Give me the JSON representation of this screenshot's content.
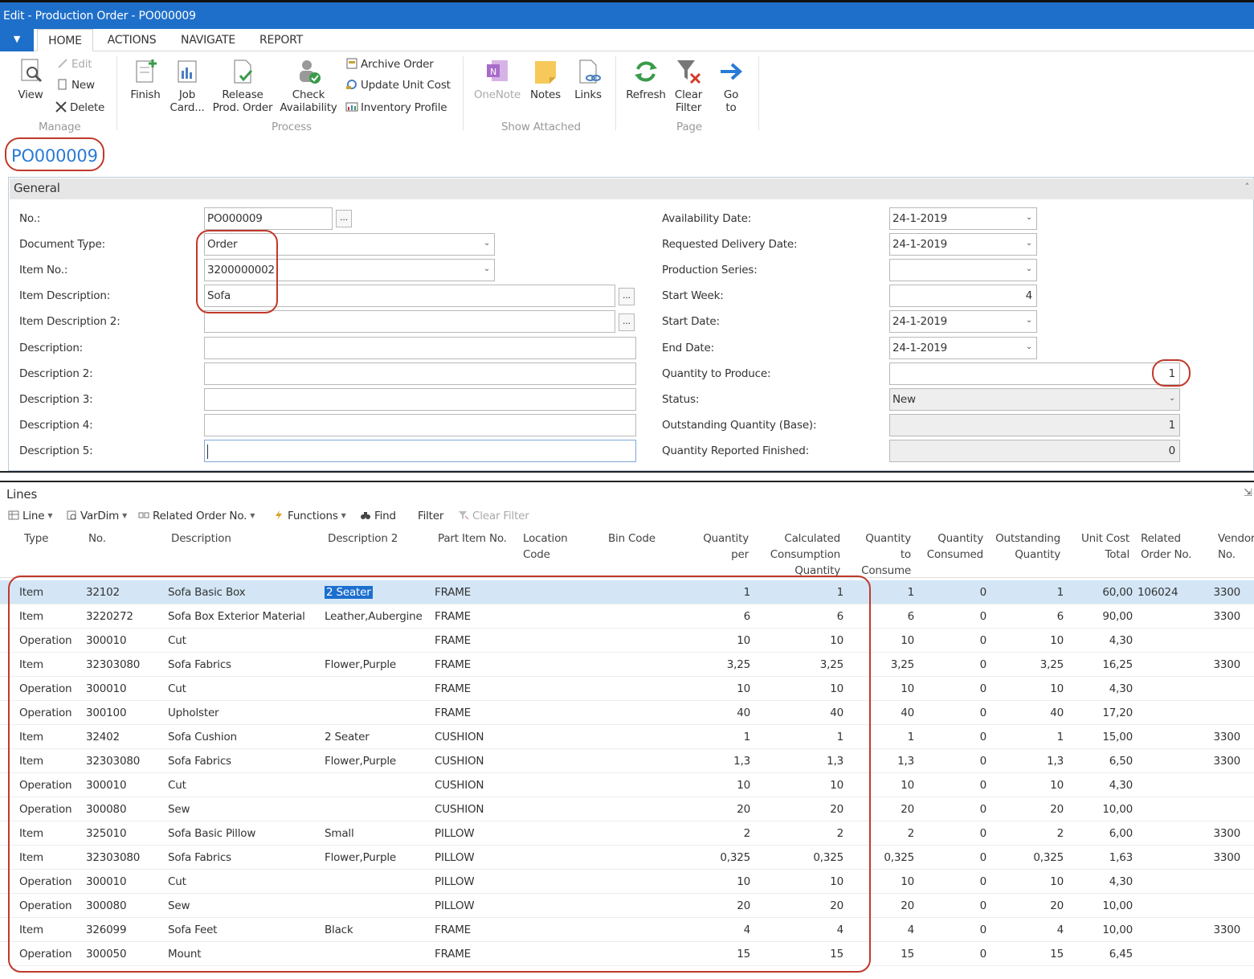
{
  "window": {
    "title": "Edit - Production Order - PO000009"
  },
  "ribbon": {
    "menu_arrow": "▼",
    "tabs": [
      "HOME",
      "ACTIONS",
      "NAVIGATE",
      "REPORT"
    ],
    "view": "View",
    "edit": "Edit",
    "new": "New",
    "delete": "Delete",
    "finish": "Finish",
    "job_card": [
      "Job",
      "Card..."
    ],
    "release": [
      "Release",
      "Prod. Order"
    ],
    "check": [
      "Check",
      "Availability"
    ],
    "archive": "Archive Order",
    "update_cost": "Update Unit Cost",
    "inventory_profile": "Inventory Profile",
    "onenote": "OneNote",
    "notes": "Notes",
    "links": "Links",
    "refresh": "Refresh",
    "clear_filter": [
      "Clear",
      "Filter"
    ],
    "goto": [
      "Go",
      "to"
    ],
    "groups": {
      "manage": "Manage",
      "process": "Process",
      "show_attached": "Show Attached",
      "page": "Page"
    }
  },
  "doc_title": "PO000009",
  "general": {
    "title": "General",
    "collapse": "˄",
    "dots": "...",
    "dropdown": "⌄",
    "left": [
      {
        "label": "No.:",
        "value": "PO000009"
      },
      {
        "label": "Document Type:",
        "value": "Order"
      },
      {
        "label": "Item No.:",
        "value": "3200000002"
      },
      {
        "label": "Item Description:",
        "value": "Sofa"
      },
      {
        "label": "Item Description 2:",
        "value": ""
      },
      {
        "label": "Description:",
        "value": ""
      },
      {
        "label": "Description 2:",
        "value": ""
      },
      {
        "label": "Description 3:",
        "value": ""
      },
      {
        "label": "Description 4:",
        "value": ""
      },
      {
        "label": "Description 5:",
        "value": ""
      }
    ],
    "right": [
      {
        "label": "Availability Date:",
        "value": "24-1-2019"
      },
      {
        "label": "Requested Delivery Date:",
        "value": "24-1-2019"
      },
      {
        "label": "Production Series:",
        "value": ""
      },
      {
        "label": "Start Week:",
        "value": "4"
      },
      {
        "label": "Start Date:",
        "value": "24-1-2019"
      },
      {
        "label": "End Date:",
        "value": "24-1-2019"
      },
      {
        "label": "Quantity to Produce:",
        "value": "1"
      },
      {
        "label": "Status:",
        "value": "New"
      },
      {
        "label": "Outstanding Quantity (Base):",
        "value": "1"
      },
      {
        "label": "Quantity Reported Finished:",
        "value": "0"
      }
    ]
  },
  "lines": {
    "title": "Lines",
    "pin": "⇲",
    "toolbar": {
      "line": "Line",
      "vardim": "VarDim",
      "related": "Related Order No.",
      "functions": "Functions",
      "find": "Find",
      "filter": "Filter",
      "clear_filter": "Clear Filter",
      "arrow": "▼"
    },
    "headers": {
      "type": "Type",
      "no": "No.",
      "desc": "Description",
      "desc2": "Description 2",
      "part": "Part Item No.",
      "loc": "Location\nCode",
      "bin": "Bin Code",
      "qper": "Quantity\nper",
      "calc": "Calculated\nConsumption\nQuantity",
      "qcons": "Quantity\nto\nConsume",
      "qconsumed": "Quantity\nConsumed",
      "outstanding": "Outstanding\nQuantity",
      "cost": "Unit Cost\nTotal",
      "related": "Related\nOrder No.",
      "vendor": "Vendor\nNo."
    },
    "rows": [
      {
        "type": "Item",
        "no": "32102",
        "desc": "Sofa Basic Box",
        "desc2": "2 Seater",
        "part": "FRAME",
        "qper": "1",
        "calc": "1",
        "qcons": "1",
        "qconsumed": "0",
        "outstanding": "1",
        "cost": "60,00",
        "related": "106024",
        "vendor": "3300"
      },
      {
        "type": "Item",
        "no": "3220272",
        "desc": "Sofa Box Exterior Material",
        "desc2": "Leather,Aubergine",
        "part": "FRAME",
        "qper": "6",
        "calc": "6",
        "qcons": "6",
        "qconsumed": "0",
        "outstanding": "6",
        "cost": "90,00",
        "related": "",
        "vendor": "3300"
      },
      {
        "type": "Operation",
        "no": "300010",
        "desc": "Cut",
        "desc2": "",
        "part": "FRAME",
        "qper": "10",
        "calc": "10",
        "qcons": "10",
        "qconsumed": "0",
        "outstanding": "10",
        "cost": "4,30",
        "related": "",
        "vendor": ""
      },
      {
        "type": "Item",
        "no": "32303080",
        "desc": "Sofa Fabrics",
        "desc2": "Flower,Purple",
        "part": "FRAME",
        "qper": "3,25",
        "calc": "3,25",
        "qcons": "3,25",
        "qconsumed": "0",
        "outstanding": "3,25",
        "cost": "16,25",
        "related": "",
        "vendor": "3300"
      },
      {
        "type": "Operation",
        "no": "300010",
        "desc": "Cut",
        "desc2": "",
        "part": "FRAME",
        "qper": "10",
        "calc": "10",
        "qcons": "10",
        "qconsumed": "0",
        "outstanding": "10",
        "cost": "4,30",
        "related": "",
        "vendor": ""
      },
      {
        "type": "Operation",
        "no": "300100",
        "desc": "Upholster",
        "desc2": "",
        "part": "FRAME",
        "qper": "40",
        "calc": "40",
        "qcons": "40",
        "qconsumed": "0",
        "outstanding": "40",
        "cost": "17,20",
        "related": "",
        "vendor": ""
      },
      {
        "type": "Item",
        "no": "32402",
        "desc": "Sofa Cushion",
        "desc2": "2 Seater",
        "part": "CUSHION",
        "qper": "1",
        "calc": "1",
        "qcons": "1",
        "qconsumed": "0",
        "outstanding": "1",
        "cost": "15,00",
        "related": "",
        "vendor": "3300"
      },
      {
        "type": "Item",
        "no": "32303080",
        "desc": "Sofa Fabrics",
        "desc2": "Flower,Purple",
        "part": "CUSHION",
        "qper": "1,3",
        "calc": "1,3",
        "qcons": "1,3",
        "qconsumed": "0",
        "outstanding": "1,3",
        "cost": "6,50",
        "related": "",
        "vendor": "3300"
      },
      {
        "type": "Operation",
        "no": "300010",
        "desc": "Cut",
        "desc2": "",
        "part": "CUSHION",
        "qper": "10",
        "calc": "10",
        "qcons": "10",
        "qconsumed": "0",
        "outstanding": "10",
        "cost": "4,30",
        "related": "",
        "vendor": ""
      },
      {
        "type": "Operation",
        "no": "300080",
        "desc": "Sew",
        "desc2": "",
        "part": "CUSHION",
        "qper": "20",
        "calc": "20",
        "qcons": "20",
        "qconsumed": "0",
        "outstanding": "20",
        "cost": "10,00",
        "related": "",
        "vendor": ""
      },
      {
        "type": "Item",
        "no": "325010",
        "desc": "Sofa Basic Pillow",
        "desc2": "Small",
        "part": "PILLOW",
        "qper": "2",
        "calc": "2",
        "qcons": "2",
        "qconsumed": "0",
        "outstanding": "2",
        "cost": "6,00",
        "related": "",
        "vendor": "3300"
      },
      {
        "type": "Item",
        "no": "32303080",
        "desc": "Sofa Fabrics",
        "desc2": "Flower,Purple",
        "part": "PILLOW",
        "qper": "0,325",
        "calc": "0,325",
        "qcons": "0,325",
        "qconsumed": "0",
        "outstanding": "0,325",
        "cost": "1,63",
        "related": "",
        "vendor": "3300"
      },
      {
        "type": "Operation",
        "no": "300010",
        "desc": "Cut",
        "desc2": "",
        "part": "PILLOW",
        "qper": "10",
        "calc": "10",
        "qcons": "10",
        "qconsumed": "0",
        "outstanding": "10",
        "cost": "4,30",
        "related": "",
        "vendor": ""
      },
      {
        "type": "Operation",
        "no": "300080",
        "desc": "Sew",
        "desc2": "",
        "part": "PILLOW",
        "qper": "20",
        "calc": "20",
        "qcons": "20",
        "qconsumed": "0",
        "outstanding": "20",
        "cost": "10,00",
        "related": "",
        "vendor": ""
      },
      {
        "type": "Item",
        "no": "326099",
        "desc": "Sofa Feet",
        "desc2": "Black",
        "part": "FRAME",
        "qper": "4",
        "calc": "4",
        "qcons": "4",
        "qconsumed": "0",
        "outstanding": "4",
        "cost": "10,00",
        "related": "",
        "vendor": "3300"
      },
      {
        "type": "Operation",
        "no": "300050",
        "desc": "Mount",
        "desc2": "",
        "part": "FRAME",
        "qper": "15",
        "calc": "15",
        "qcons": "15",
        "qconsumed": "0",
        "outstanding": "15",
        "cost": "6,45",
        "related": "",
        "vendor": ""
      }
    ]
  },
  "colors": {
    "accent": "#1e6fc9",
    "annotation": "#c0392b",
    "selected_row": "#d4e6f6"
  }
}
